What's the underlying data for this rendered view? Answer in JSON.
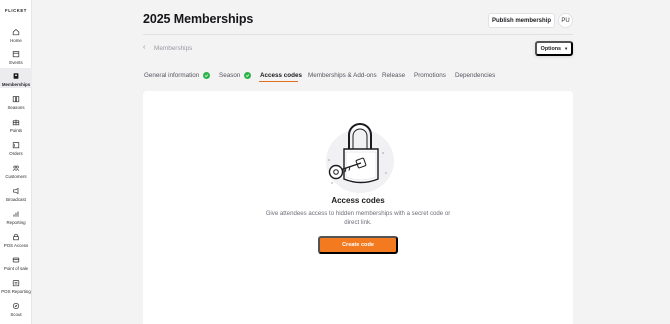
{
  "brand": {
    "logo_text": "FLICKET",
    "accent": "#f47a20",
    "success": "#2bb34a"
  },
  "sidebar": {
    "items": [
      {
        "label": "Home",
        "icon": "home-icon"
      },
      {
        "label": "Events",
        "icon": "calendar-icon"
      },
      {
        "label": "Memberships",
        "icon": "membership-icon",
        "active": true
      },
      {
        "label": "Seasons",
        "icon": "book-icon"
      },
      {
        "label": "Points",
        "icon": "gift-icon"
      },
      {
        "label": "Orders",
        "icon": "orders-icon"
      },
      {
        "label": "Customers",
        "icon": "customers-icon"
      },
      {
        "label": "Broadcast",
        "icon": "broadcast-icon"
      },
      {
        "label": "Reporting",
        "icon": "chart-icon"
      },
      {
        "label": "POS Access",
        "icon": "lock-icon"
      },
      {
        "label": "Point of sale",
        "icon": "pos-icon"
      },
      {
        "label": "POS Reporting",
        "icon": "pos-report-icon"
      },
      {
        "label": "Scout",
        "icon": "scout-icon"
      }
    ]
  },
  "header": {
    "title": "2025 Memberships",
    "publish_label": "Publish membership",
    "avatar_initials": "PU"
  },
  "breadcrumb": {
    "label": "Memberships"
  },
  "options": {
    "label": "Options"
  },
  "tabs": [
    {
      "label": "General information",
      "complete": true
    },
    {
      "label": "Season",
      "complete": true
    },
    {
      "label": "Access codes",
      "active": true
    },
    {
      "label": "Memberships & Add-ons"
    },
    {
      "label": "Release"
    },
    {
      "label": "Promotions"
    },
    {
      "label": "Dependencies"
    }
  ],
  "empty_state": {
    "title": "Access codes",
    "description": "Give attendees access to hidden memberships with a secret code or direct link.",
    "button_label": "Create code",
    "illustration": "padlock-key-illustration"
  }
}
